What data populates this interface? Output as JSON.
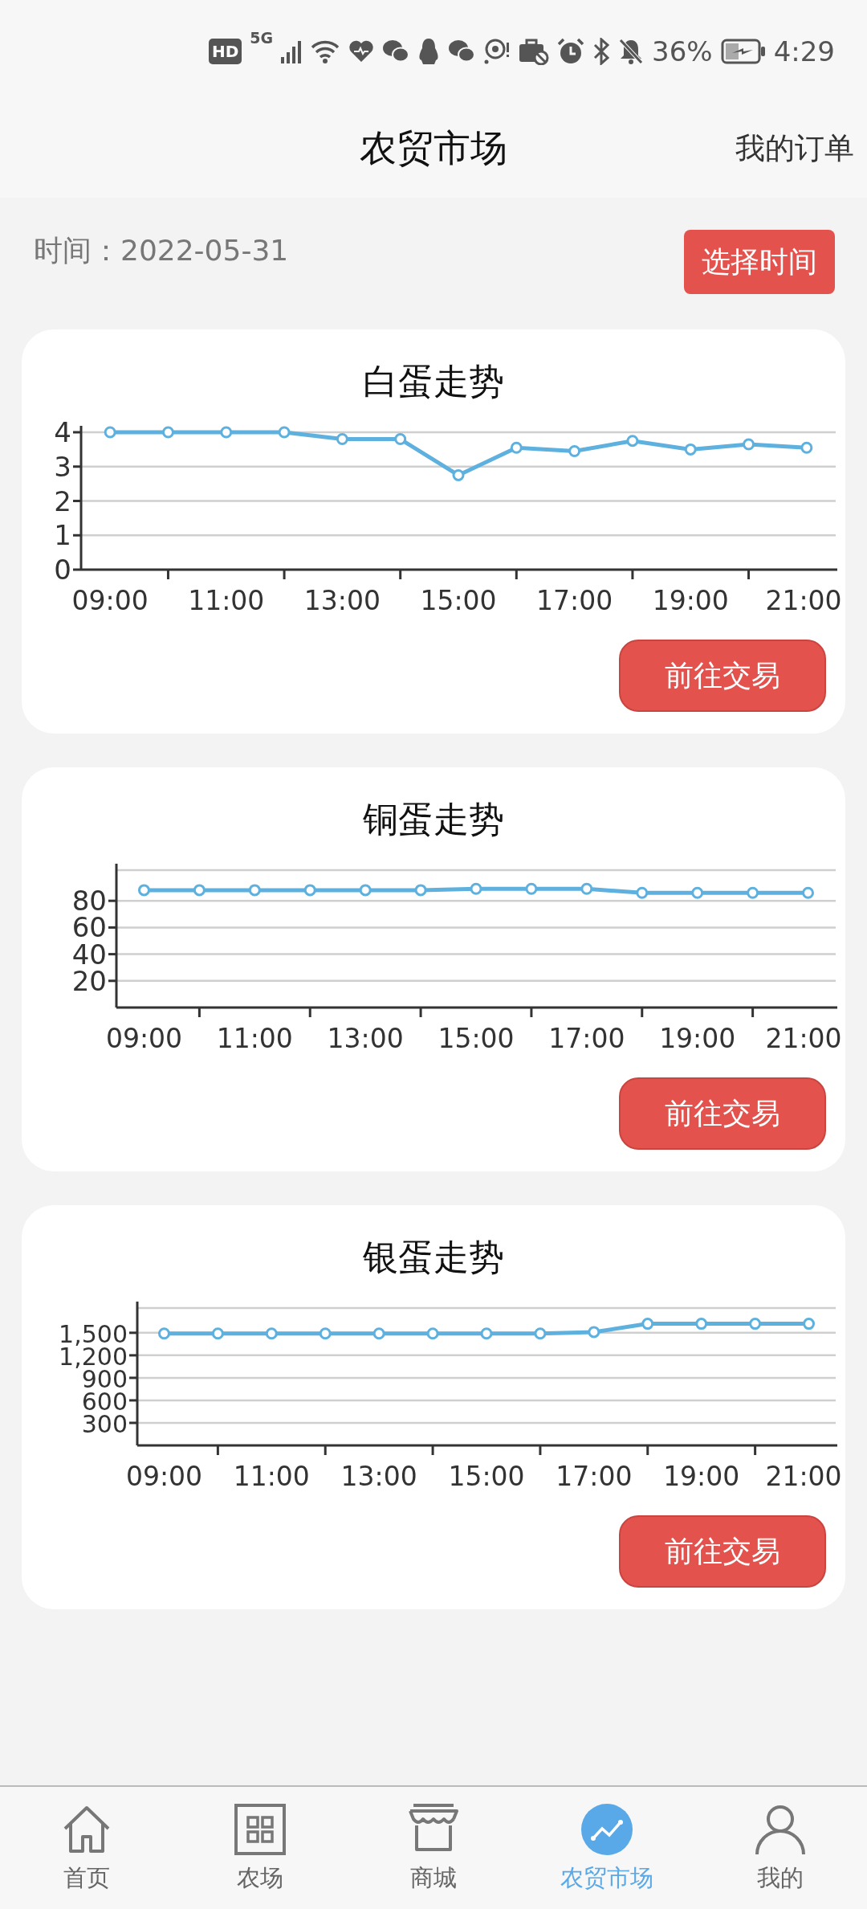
{
  "status_bar": {
    "hd": "HD",
    "network": "5G",
    "battery": "36%",
    "time": "4:29"
  },
  "header": {
    "title": "农贸市场",
    "action": "我的订单"
  },
  "date_label": "时间：2022-05-31",
  "select_button": "选择时间",
  "cards": [
    {
      "title": "白蛋走势",
      "button": "前往交易",
      "chart_data": {
        "type": "line",
        "grid": true,
        "x": [
          9,
          10,
          11,
          12,
          13,
          14,
          15,
          16,
          17,
          18,
          19,
          20,
          21
        ],
        "xlim": [
          8.5,
          21.5
        ],
        "xticks": [
          {
            "value": 9,
            "label": "09:00"
          },
          {
            "value": 11,
            "label": "11:00"
          },
          {
            "value": 13,
            "label": "13:00"
          },
          {
            "value": 15,
            "label": "15:00"
          },
          {
            "value": 17,
            "label": "17:00"
          },
          {
            "value": 19,
            "label": "19:00"
          },
          {
            "value": 21,
            "label": "21:00"
          }
        ],
        "ylim": [
          0,
          4
        ],
        "yticks": [
          0,
          1,
          2,
          3,
          4
        ],
        "series": [
          {
            "color": "#5eb1de",
            "marker": "circle",
            "values": [
              4,
              4,
              4,
              4,
              3.8,
              3.8,
              2.75,
              3.55,
              3.45,
              3.75,
              3.5,
              3.65,
              3.55
            ]
          }
        ]
      }
    },
    {
      "title": "铜蛋走势",
      "button": "前往交易",
      "chart_data": {
        "type": "line",
        "grid": true,
        "x": [
          9,
          10,
          11,
          12,
          13,
          14,
          15,
          16,
          17,
          18,
          19,
          20,
          21
        ],
        "xlim": [
          8.5,
          21.5
        ],
        "xticks": [
          {
            "value": 9,
            "label": "09:00"
          },
          {
            "value": 11,
            "label": "11:00"
          },
          {
            "value": 13,
            "label": "13:00"
          },
          {
            "value": 15,
            "label": "15:00"
          },
          {
            "value": 17,
            "label": "17:00"
          },
          {
            "value": 19,
            "label": "19:00"
          },
          {
            "value": 21,
            "label": "21:00"
          }
        ],
        "ylim": [
          0,
          103
        ],
        "yticks": [
          20,
          40,
          60,
          80
        ],
        "series": [
          {
            "color": "#5eb1de",
            "marker": "circle",
            "values": [
              88,
              88,
              88,
              88,
              88,
              88,
              89,
              89,
              89,
              86,
              86,
              86,
              86
            ]
          }
        ]
      }
    },
    {
      "title": "银蛋走势",
      "button": "前往交易",
      "chart_data": {
        "type": "line",
        "grid": true,
        "x": [
          9,
          10,
          11,
          12,
          13,
          14,
          15,
          16,
          17,
          18,
          19,
          20,
          21
        ],
        "xlim": [
          8.5,
          21.5
        ],
        "xticks": [
          {
            "value": 9,
            "label": "09:00"
          },
          {
            "value": 11,
            "label": "11:00"
          },
          {
            "value": 13,
            "label": "13:00"
          },
          {
            "value": 15,
            "label": "15:00"
          },
          {
            "value": 17,
            "label": "17:00"
          },
          {
            "value": 19,
            "label": "19:00"
          },
          {
            "value": 21,
            "label": "21:00"
          }
        ],
        "ylim": [
          0,
          1830
        ],
        "yticks": [
          {
            "value": 300,
            "label": "300"
          },
          {
            "value": 600,
            "label": "600"
          },
          {
            "value": 900,
            "label": "900"
          },
          {
            "value": 1200,
            "label": "1,200"
          },
          {
            "value": 1500,
            "label": "1,500"
          }
        ],
        "series": [
          {
            "color": "#5eb1de",
            "marker": "circle",
            "values": [
              1490,
              1490,
              1490,
              1490,
              1490,
              1490,
              1490,
              1490,
              1510,
              1620,
              1620,
              1620,
              1620
            ]
          }
        ]
      }
    }
  ],
  "nav": [
    {
      "label": "首页",
      "selected": false
    },
    {
      "label": "农场",
      "selected": false
    },
    {
      "label": "商城",
      "selected": false
    },
    {
      "label": "农贸市场",
      "selected": true
    },
    {
      "label": "我的",
      "selected": false
    }
  ]
}
